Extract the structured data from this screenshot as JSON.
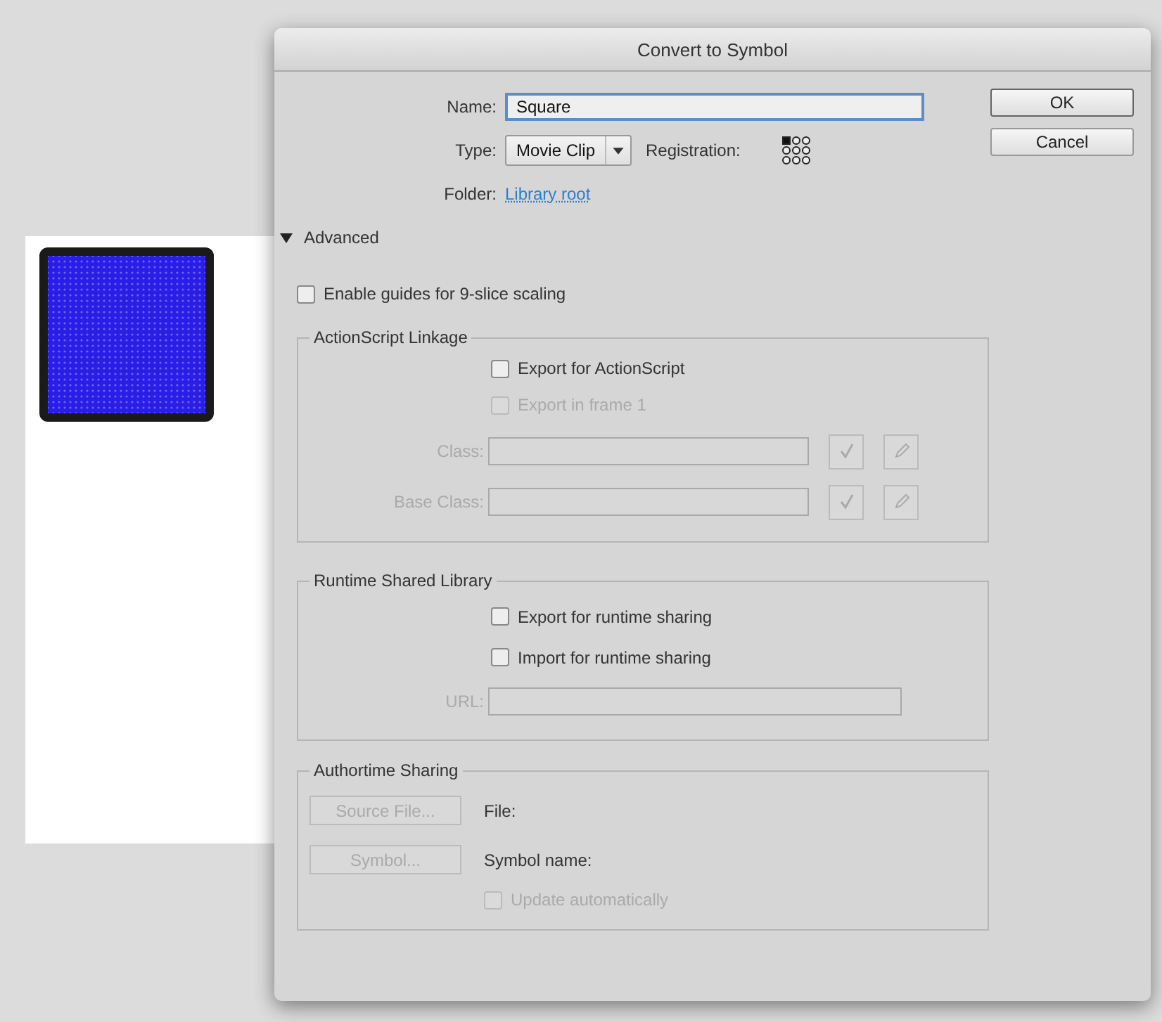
{
  "window": {
    "title": "Convert to Symbol"
  },
  "name_field": {
    "label": "Name:",
    "value": "Square"
  },
  "type_field": {
    "label": "Type:",
    "value": "Movie Clip"
  },
  "registration": {
    "label": "Registration:",
    "points": [
      {
        "selected": true
      },
      {
        "selected": false
      },
      {
        "selected": false
      },
      {
        "selected": false
      },
      {
        "selected": false
      },
      {
        "selected": false
      },
      {
        "selected": false
      },
      {
        "selected": false
      },
      {
        "selected": false
      }
    ]
  },
  "folder": {
    "label": "Folder:",
    "link": "Library root"
  },
  "advanced": {
    "label": "Advanced",
    "expanded": true
  },
  "enable_guides": {
    "label": "Enable guides for 9-slice scaling",
    "checked": false
  },
  "actionscript_linkage": {
    "title": "ActionScript Linkage",
    "checkboxes": [
      {
        "label": "Export for ActionScript",
        "checked": false,
        "disabled": false
      },
      {
        "label": "Export in frame 1",
        "checked": false,
        "disabled": true
      }
    ],
    "fields": [
      {
        "label": "Class:",
        "disabled": true
      },
      {
        "label": "Base Class:",
        "disabled": true
      }
    ]
  },
  "runtime_shared_library": {
    "title": "Runtime Shared Library",
    "checkboxes": [
      {
        "label": "Export for runtime sharing",
        "checked": false,
        "disabled": false
      },
      {
        "label": "Import for runtime sharing",
        "checked": false,
        "disabled": false
      }
    ],
    "url": {
      "label": "URL:",
      "disabled": true
    }
  },
  "authortime_sharing": {
    "title": "Authortime Sharing",
    "rows": [
      {
        "button": "Source File...",
        "label": "File:",
        "disabled": true
      },
      {
        "button": "Symbol...",
        "label": "Symbol name:",
        "disabled": true
      }
    ],
    "update": {
      "label": "Update automatically",
      "checked": false,
      "disabled": true
    }
  },
  "buttons": [
    {
      "label": "OK",
      "default": true
    },
    {
      "label": "Cancel",
      "default": false
    }
  ]
}
